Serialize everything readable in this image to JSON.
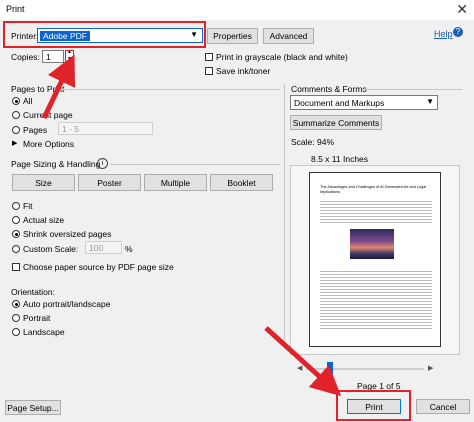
{
  "window": {
    "title": "Print",
    "close_glyph": "✕"
  },
  "printer": {
    "label": "Printer:",
    "value": "Adobe PDF",
    "properties": "Properties",
    "advanced": "Advanced",
    "help": "Help"
  },
  "copies": {
    "label": "Copies:",
    "value": "1"
  },
  "options": {
    "grayscale": "Print in grayscale (black and white)",
    "save_ink": "Save ink/toner"
  },
  "pages": {
    "title": "Pages to Print",
    "all": "All",
    "current": "Current page",
    "pages": "Pages",
    "range_placeholder": "1 - 5",
    "more": "More Options"
  },
  "sizing": {
    "title": "Page Sizing & Handling",
    "info_glyph": "i",
    "tabs": [
      "Size",
      "Poster",
      "Multiple",
      "Booklet"
    ],
    "fit": "Fit",
    "actual": "Actual size",
    "shrink": "Shrink oversized pages",
    "custom": "Custom Scale:",
    "custom_value": "100",
    "percent": "%",
    "paper_source": "Choose paper source by PDF page size"
  },
  "orientation": {
    "title": "Orientation:",
    "auto": "Auto portrait/landscape",
    "portrait": "Portrait",
    "landscape": "Landscape"
  },
  "comments": {
    "title": "Comments & Forms",
    "value": "Document and Markups",
    "summarize": "Summarize Comments"
  },
  "preview": {
    "scale": "Scale:  94%",
    "paper": "8.5 x 11 Inches",
    "page_label": "Page 1 of 5",
    "doc_title": "The Advantages and Challenges of AI-Generated Art and Legal Implications"
  },
  "footer": {
    "page_setup": "Page Setup...",
    "print": "Print",
    "cancel": "Cancel"
  },
  "colors": {
    "highlight": "#e0222b",
    "selection": "#0a64d2"
  }
}
